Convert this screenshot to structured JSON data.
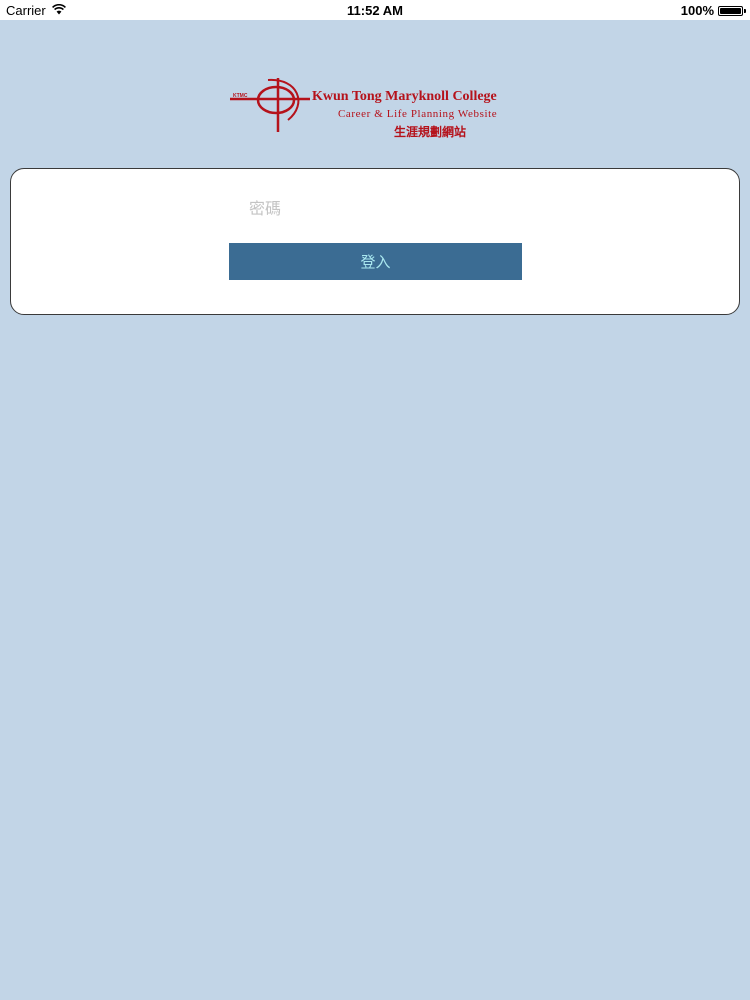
{
  "status_bar": {
    "carrier": "Carrier",
    "time": "11:52 AM",
    "battery": "100%",
    "battery_level": 1.0,
    "icons": [
      "wifi-icon",
      "battery-icon"
    ]
  },
  "logo": {
    "abbr": "KTMC",
    "school_name": "Kwun Tong Maryknoll College",
    "subtitle": "Career & Life Planning Website",
    "chinese_subtitle": "生涯規劃網站",
    "brand_color": "#b5121b"
  },
  "login": {
    "password_placeholder": "密碼",
    "password_value": "",
    "login_label": "登入"
  },
  "colors": {
    "background": "#c2d5e7",
    "card": "#ffffff",
    "button": "#3b6c93",
    "button_text": "#a9e7ef"
  }
}
